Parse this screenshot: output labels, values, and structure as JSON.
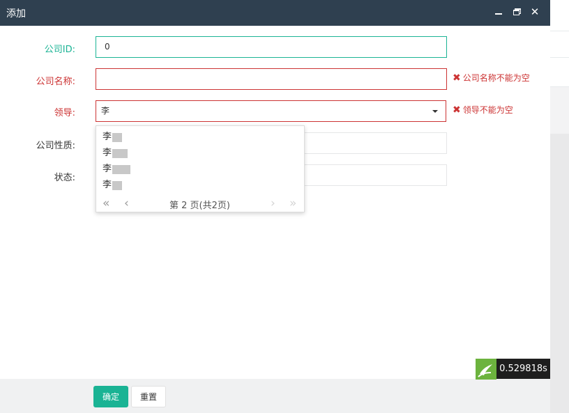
{
  "dialog": {
    "title": "添加",
    "controls": {
      "minimize": "minimize",
      "maximize": "maximize",
      "close": "✕"
    }
  },
  "form": {
    "company_id": {
      "label": "公司ID:",
      "value": "0"
    },
    "company_name": {
      "label": "公司名称:",
      "value": "",
      "error": "公司名称不能为空"
    },
    "leader": {
      "label": "领导:",
      "value": "李",
      "error": "领导不能为空"
    },
    "company_type": {
      "label": "公司性质:",
      "value": ""
    },
    "status": {
      "label": "状态:",
      "value": ""
    }
  },
  "dropdown": {
    "items": [
      "李",
      "李",
      "李",
      "李"
    ],
    "page_info": "第 2 页(共2页)",
    "nav": {
      "first": "«",
      "prev": "‹",
      "next": "›",
      "last": "»"
    }
  },
  "footer": {
    "confirm": "确定",
    "reset": "重置"
  },
  "timer": {
    "value": "0.529818s"
  },
  "colors": {
    "accent": "#1ab394",
    "error": "#cc3333",
    "titlebar": "#2f4050"
  }
}
